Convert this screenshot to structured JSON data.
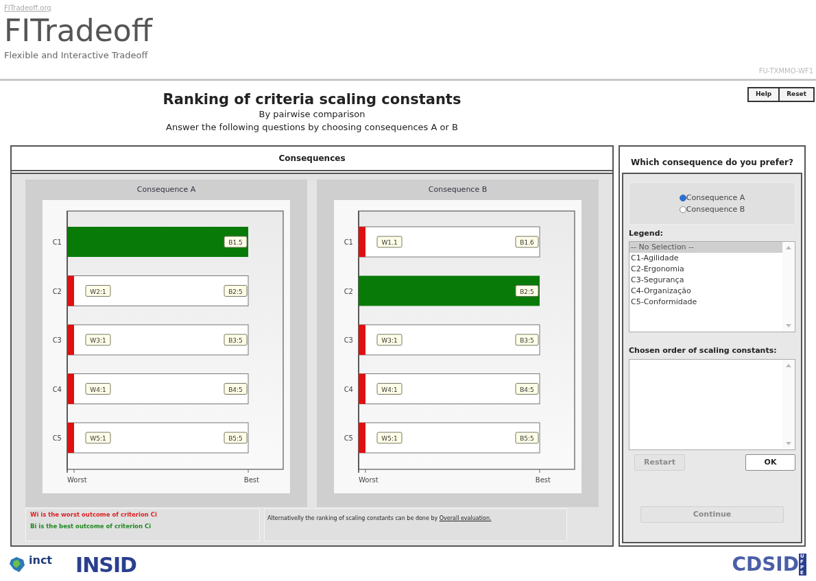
{
  "header": {
    "site_link": "FITradeoff.org",
    "logo_title": "FITradeoff",
    "logo_subtitle": "Flexible and Interactive Tradeoff",
    "code": "FU-TXMMO-WF1"
  },
  "top_buttons": [
    "Help",
    "Reset"
  ],
  "title": "Ranking of criteria scaling constants",
  "subtitle": "By pairwise comparison",
  "instruction": "Answer the following questions by choosing consequences A or B",
  "consequences_panel": {
    "title": "Consequences",
    "charts": [
      {
        "title": "Consequence A",
        "axis_labels": [
          "Worst",
          "Best"
        ],
        "rows": [
          {
            "criterion": "C1",
            "kind": "best",
            "worst_label": "",
            "best_label": "B1.5"
          },
          {
            "criterion": "C2",
            "kind": "worst",
            "worst_label": "W2:1",
            "best_label": "B2:5"
          },
          {
            "criterion": "C3",
            "kind": "worst",
            "worst_label": "W3:1",
            "best_label": "B3:5"
          },
          {
            "criterion": "C4",
            "kind": "worst",
            "worst_label": "W4:1",
            "best_label": "B4:5"
          },
          {
            "criterion": "C5",
            "kind": "worst",
            "worst_label": "W5:1",
            "best_label": "B5:5"
          }
        ]
      },
      {
        "title": "Consequence B",
        "axis_labels": [
          "Worst",
          "Best"
        ],
        "rows": [
          {
            "criterion": "C1",
            "kind": "worst",
            "worst_label": "W1.1",
            "best_label": "B1.6"
          },
          {
            "criterion": "C2",
            "kind": "best",
            "worst_label": "",
            "best_label": "B2:5"
          },
          {
            "criterion": "C3",
            "kind": "worst",
            "worst_label": "W3:1",
            "best_label": "B3:5"
          },
          {
            "criterion": "C4",
            "kind": "worst",
            "worst_label": "W4:1",
            "best_label": "B4:5"
          },
          {
            "criterion": "C5",
            "kind": "worst",
            "worst_label": "W5:1",
            "best_label": "B5:5"
          }
        ]
      }
    ],
    "notes": [
      {
        "text": "Wi is the worst outcome of criterion Ci",
        "color": "#dd2222"
      },
      {
        "text": "Bi is the best outcome of criterion Ci",
        "color": "#228822"
      }
    ],
    "alternative_text": "Alternativelly the ranking of scaling constants can be done by ",
    "alternative_link": "Overall evaluation."
  },
  "preference_panel": {
    "title": "Which consequence do you prefer?",
    "options": [
      {
        "label": "Consequence A",
        "selected": true
      },
      {
        "label": "Consequence B",
        "selected": false
      }
    ],
    "legend_label": "Legend:",
    "legend_items": [
      {
        "label": "-- No Selection --",
        "selected": true
      },
      {
        "label": "C1-Agilidade",
        "selected": false
      },
      {
        "label": "C2-Ergonomia",
        "selected": false
      },
      {
        "label": "C3-Segurança",
        "selected": false
      },
      {
        "label": "C4-Organização",
        "selected": false
      },
      {
        "label": "C5-Conformidade",
        "selected": false
      }
    ],
    "order_label": "Chosen order of scaling constants:",
    "buttons": [
      {
        "label": "Restart",
        "disabled": true
      },
      {
        "label": "OK",
        "disabled": false
      }
    ],
    "continue": {
      "label": "Continue",
      "disabled": true
    }
  },
  "footer": {
    "logos": [
      "inct",
      "INSID"
    ],
    "right_logo": "CDSID",
    "right_logo_side": "UFPE"
  }
}
